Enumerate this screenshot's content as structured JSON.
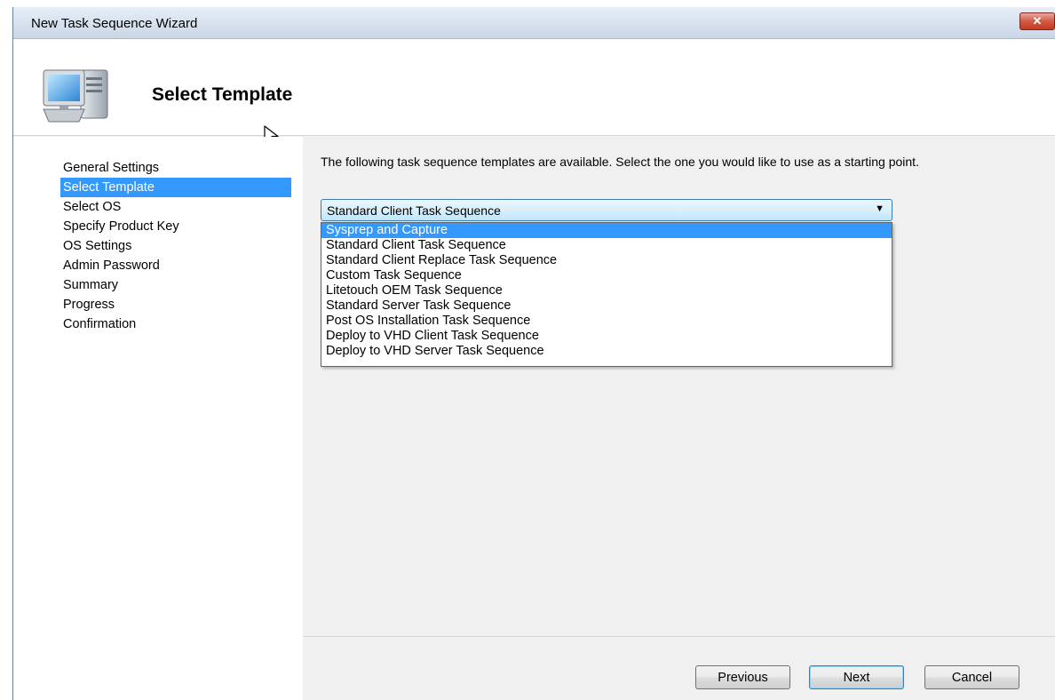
{
  "window": {
    "title": "New Task Sequence Wizard",
    "close_label": "✕"
  },
  "header": {
    "title": "Select Template"
  },
  "sidebar": {
    "items": [
      {
        "label": "General Settings"
      },
      {
        "label": "Select Template"
      },
      {
        "label": "Select OS"
      },
      {
        "label": "Specify Product Key"
      },
      {
        "label": "OS Settings"
      },
      {
        "label": "Admin Password"
      },
      {
        "label": "Summary"
      },
      {
        "label": "Progress"
      },
      {
        "label": "Confirmation"
      }
    ],
    "active_index": 1
  },
  "content": {
    "instructions": "The following task sequence templates are available.  Select the one you would like to use as a starting point.",
    "template_select": {
      "selected": "Standard Client Task Sequence",
      "options": [
        "Sysprep and Capture",
        "Standard Client Task Sequence",
        "Standard Client Replace Task Sequence",
        "Custom Task Sequence",
        "Litetouch OEM Task Sequence",
        "Standard Server Task Sequence",
        "Post OS Installation Task Sequence",
        "Deploy to VHD Client Task Sequence",
        "Deploy to VHD Server Task Sequence"
      ],
      "highlighted_index": 0
    }
  },
  "footer": {
    "previous_label": "Previous",
    "next_label": "Next",
    "cancel_label": "Cancel"
  },
  "icons": {
    "header": "computer-monitor-icon",
    "cursor": "mouse-pointer-icon",
    "combo": "dropdown-arrow-icon"
  },
  "colors": {
    "selection": "#3399ff",
    "titlebar": "#d6e1ee",
    "close_button": "#c23a22"
  }
}
